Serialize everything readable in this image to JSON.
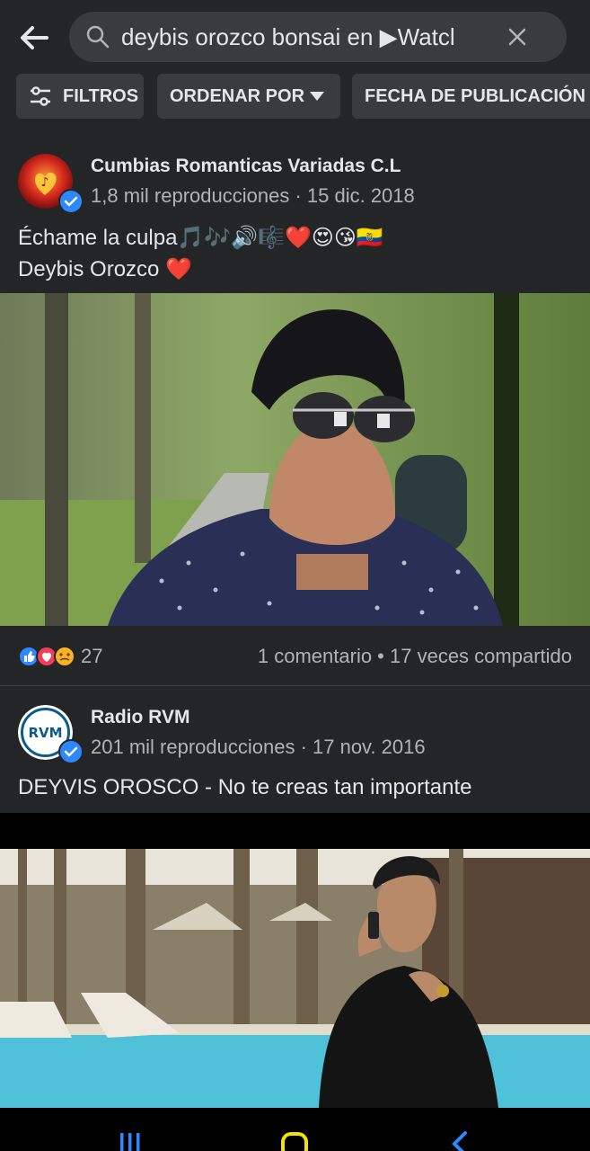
{
  "search": {
    "query": "deybis orozco bonsai en ▶Watcl"
  },
  "filters": {
    "filtros": "FILTROS",
    "ordenar": "ORDENAR POR",
    "fecha": "FECHA DE PUBLICACIÓN"
  },
  "posts": [
    {
      "page_name": "Cumbias Romanticas Variadas C.L",
      "meta": "1,8 mil reproducciones · 15 dic. 2018",
      "text_line1": "Échame la culpa🎵🎶🔊🎼❤️😍😘🇪🇨",
      "text_line2": "Deybis Orozco ❤️",
      "reaction_count": "27",
      "comments": "1 comentario • 17 veces compartido"
    },
    {
      "page_name": "Radio RVM",
      "avatar_text": "RVM",
      "meta": "201 mil reproducciones · 17 nov. 2016",
      "text_line1": "DEYVIS OROSCO - No te creas tan importante"
    }
  ],
  "colors": {
    "background": "#242526",
    "chip": "#3a3b3c",
    "accent_blue": "#2d88ff",
    "nav_icon": "#2d88ff"
  }
}
